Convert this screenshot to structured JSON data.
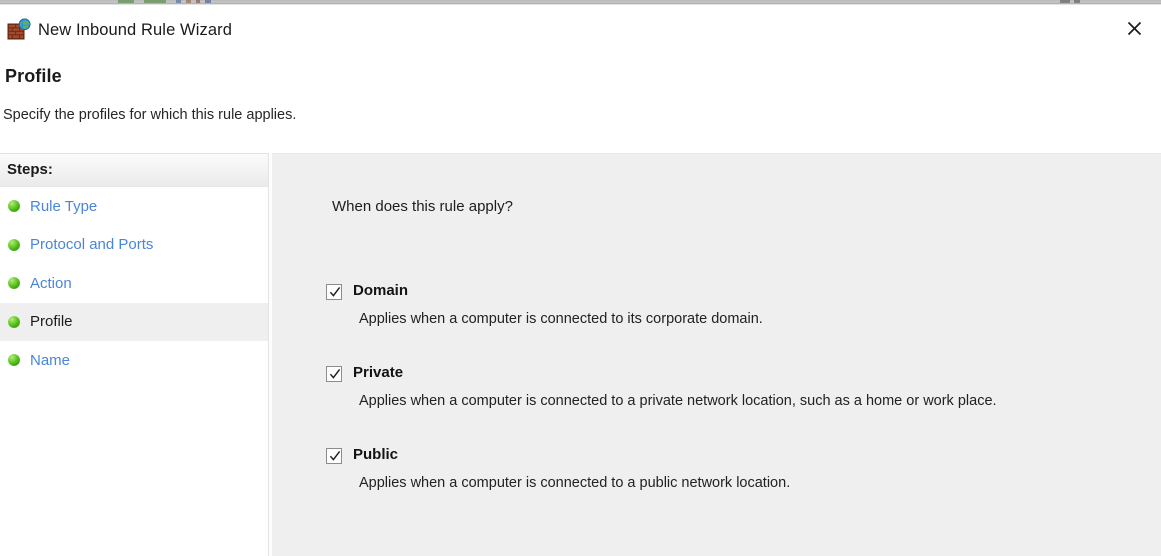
{
  "window": {
    "title": "New Inbound Rule Wizard",
    "icon": "firewall-globe-icon",
    "close_label": "✕"
  },
  "header": {
    "title": "Profile",
    "subtitle": "Specify the profiles for which this rule applies."
  },
  "sidebar": {
    "header": "Steps:",
    "items": [
      {
        "label": "Rule Type",
        "active": false
      },
      {
        "label": "Protocol and Ports",
        "active": false
      },
      {
        "label": "Action",
        "active": false
      },
      {
        "label": "Profile",
        "active": true
      },
      {
        "label": "Name",
        "active": false
      }
    ]
  },
  "content": {
    "question": "When does this rule apply?",
    "profiles": [
      {
        "label": "Domain",
        "checked": true,
        "description": "Applies when a computer is connected to its corporate domain."
      },
      {
        "label": "Private",
        "checked": true,
        "description": "Applies when a computer is connected to a private network location, such as a home or work place."
      },
      {
        "label": "Public",
        "checked": true,
        "description": "Applies when a computer is connected to a public network location."
      }
    ]
  },
  "colors": {
    "link": "#4a86d8",
    "bullet_green": "#4fbf18",
    "panel_bg": "#efefef",
    "active_row_bg": "#efefef",
    "text": "#1c1c1c"
  }
}
